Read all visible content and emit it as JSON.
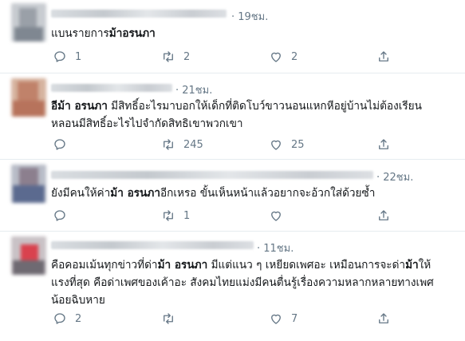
{
  "tweets": [
    {
      "time": "· 19ชม.",
      "parts": [
        {
          "text": "แบนรายการ",
          "bold": false
        },
        {
          "text": "ม้าอรนภา",
          "bold": true
        }
      ],
      "replies": "1",
      "retweets": "2",
      "likes": "2",
      "icons": [
        "reply-icon",
        "retweet-icon",
        "like-icon",
        "share-icon"
      ]
    },
    {
      "time": "· 21ชม.",
      "parts": [
        {
          "text": "อีม้า อรนภา",
          "bold": true
        },
        {
          "text": " มีสิทธิ์อะไรมาบอกให้เด็กที่ติดโบว์ขาวนอนแหกหีอยู่บ้านไม่ต้องเรียน",
          "bold": false
        },
        {
          "text": "หลอนมีสิทธิ์อะไรไปจำกัดสิทธิเขาพวกเขา",
          "bold": false,
          "break": true
        }
      ],
      "replies": "",
      "retweets": "245",
      "likes": "25",
      "icons": [
        "reply-icon",
        "retweet-icon",
        "like-icon",
        "share-icon"
      ]
    },
    {
      "time": "· 22ชม.",
      "parts": [
        {
          "text": "ยังมีคนให้ค่า",
          "bold": false
        },
        {
          "text": "ม้า อรนภา",
          "bold": true
        },
        {
          "text": "อีกเหรอ ขั้นเห็นหน้าแล้วอยากจะอ้วกใส่ด้วยซ้ำ",
          "bold": false
        }
      ],
      "replies": "",
      "retweets": "1",
      "likes": "",
      "icons": [
        "reply-icon",
        "retweet-icon",
        "like-icon",
        "share-icon"
      ]
    },
    {
      "time": "· 11ชม.",
      "parts": [
        {
          "text": "คือคอมเม้นทุกข่าวที่ด่า",
          "bold": false
        },
        {
          "text": "ม้า อรนภา",
          "bold": true
        },
        {
          "text": " มีแต่แนว ๆ เหยียดเพศอะ เหมือนการจะด่า",
          "bold": false
        },
        {
          "text": "ม้า",
          "bold": true
        },
        {
          "text": "ให้",
          "bold": false
        },
        {
          "text": "แรงที่สุด คือด่าเพศของเค้าอะ สังคมไทยแม่งมีคนตื่นรู้เรื่องความหลากหลายทางเพศ",
          "bold": false,
          "break": true
        },
        {
          "text": "น้อยฉิบหาย",
          "bold": false,
          "break": true
        }
      ],
      "replies": "2",
      "retweets": "",
      "likes": "7",
      "icons": [
        "reply-icon",
        "retweet-icon",
        "like-icon",
        "share-icon"
      ]
    }
  ]
}
